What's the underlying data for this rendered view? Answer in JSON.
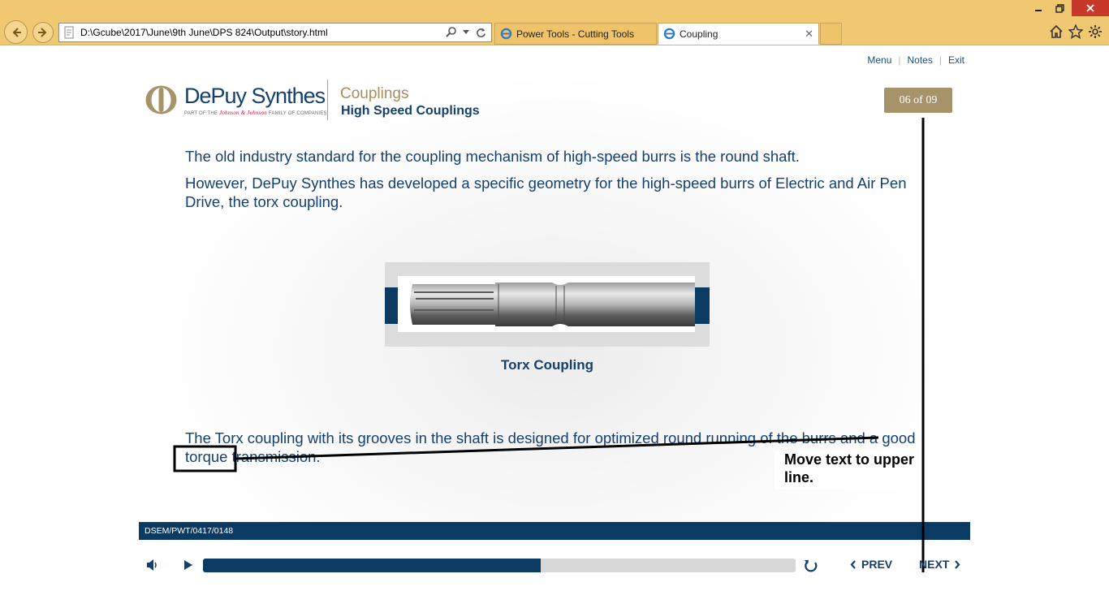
{
  "browser": {
    "address_url": "D:\\Gcube\\2017\\June\\9th June\\DPS 824\\Output\\story.html",
    "tabs": [
      {
        "label": "Power Tools - Cutting Tools",
        "active": false
      },
      {
        "label": "Coupling",
        "active": true
      }
    ],
    "icons": [
      "back-icon",
      "forward-icon",
      "search-icon",
      "refresh-icon",
      "home-icon",
      "favorites-star-icon",
      "settings-gear-icon"
    ]
  },
  "top_links": {
    "menu": "Menu",
    "notes": "Notes",
    "exit": "Exit"
  },
  "header": {
    "brand": "DePuy Synthes",
    "brand_sub_prefix": "PART OF THE",
    "brand_sub_jj": "Johnson & Johnson",
    "brand_sub_suffix": "FAMILY OF COMPANIES",
    "course_title": "Couplings",
    "course_subtitle": "High Speed Couplings",
    "page_counter": "06 of 09"
  },
  "content": {
    "paragraph_1": "The old industry standard for the coupling mechanism of high-speed burrs is the round shaft.",
    "paragraph_2": "However, DePuy Synthes has developed a specific geometry for the high-speed burrs of Electric and Air Pen Drive, the torx coupling.",
    "image_caption": "Torx Coupling",
    "paragraph_3": "The Torx coupling with its grooves in the shaft is designed for optimized round running of the burrs and a good torque transmission."
  },
  "footer": {
    "code": "DSEM/PWT/0417/0148"
  },
  "annotation": {
    "note": "Move text to upper line."
  },
  "player": {
    "progress": 0.57,
    "prev_label": "PREV",
    "next_label": "NEXT"
  },
  "colors": {
    "brand_blue": "#14406e",
    "navy_band": "#0b3a63",
    "gold": "#a6936a",
    "chrome": "#f0c872"
  }
}
